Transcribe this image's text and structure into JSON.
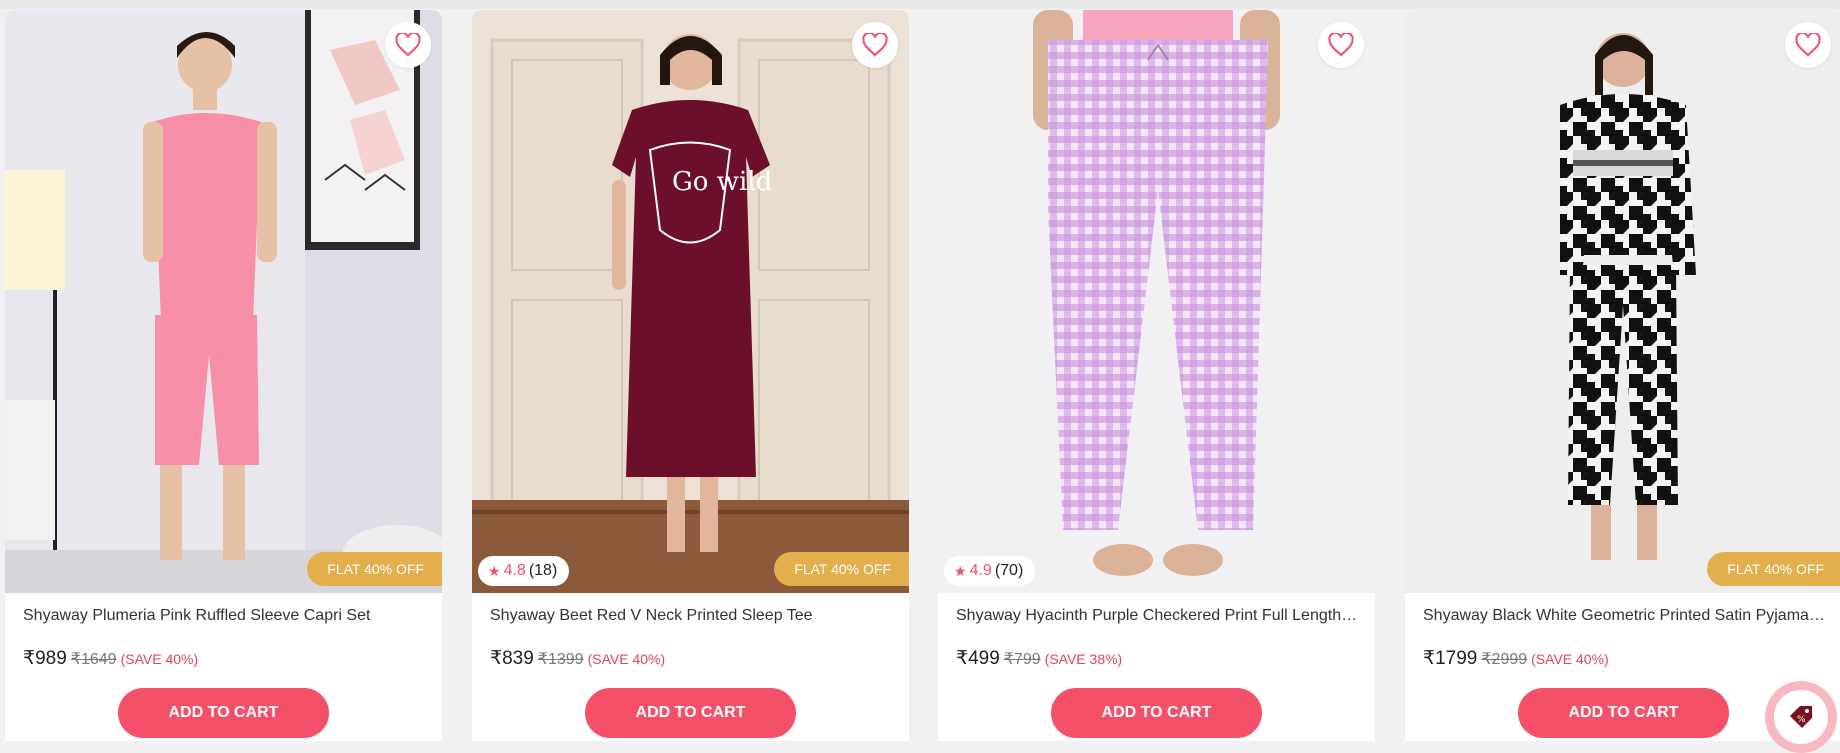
{
  "products": [
    {
      "name": "Shyaway Plumeria Pink Ruffled Sleeve Capri Set",
      "price": "₹989",
      "mrp": "₹1649",
      "save": "(SAVE 40%)",
      "badge": "FLAT 40% OFF",
      "rating": null,
      "cart_label": "ADD TO CART"
    },
    {
      "name": "Shyaway Beet Red V Neck Printed Sleep Tee",
      "price": "₹839",
      "mrp": "₹1399",
      "save": "(SAVE 40%)",
      "badge": "FLAT 40% OFF",
      "rating": {
        "value": "4.8",
        "count": "(18)"
      },
      "cart_label": "ADD TO CART"
    },
    {
      "name": "Shyaway Hyacinth Purple Checkered Print Full Length Pyjama",
      "price": "₹499",
      "mrp": "₹799",
      "save": "(SAVE 38%)",
      "badge": null,
      "rating": {
        "value": "4.9",
        "count": "(70)"
      },
      "cart_label": "ADD TO CART"
    },
    {
      "name": "Shyaway Black White Geometric Printed Satin Pyjama Set",
      "price": "₹1799",
      "mrp": "₹2999",
      "save": "(SAVE 40%)",
      "badge": "FLAT 40% OFF",
      "rating": null,
      "cart_label": "ADD TO CART"
    }
  ],
  "icons": {
    "wishlist": "heart-icon",
    "rating": "star-icon",
    "offer": "discount-tag-icon"
  },
  "colors": {
    "accent": "#f4506a",
    "badge": "#e3ae4c",
    "save_text": "#e0445c"
  }
}
